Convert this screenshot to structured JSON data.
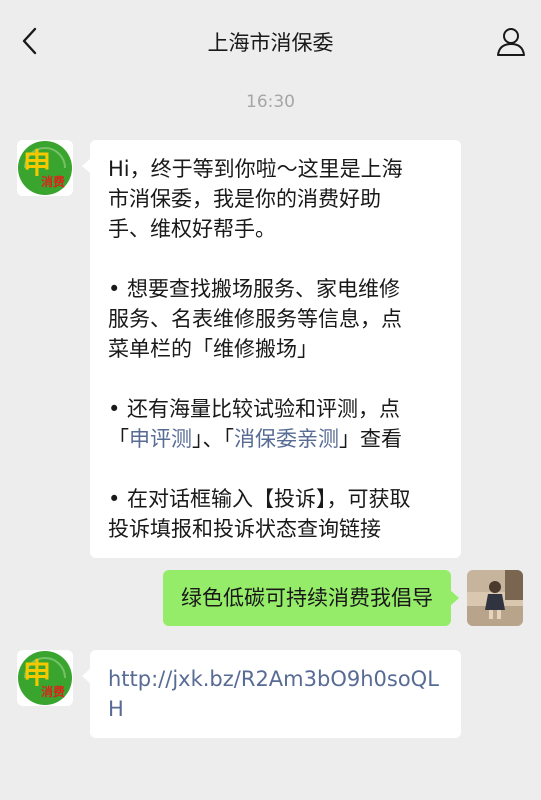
{
  "header": {
    "title": "上海市消保委",
    "back_icon": "chevron-left-icon",
    "profile_icon": "person-icon"
  },
  "chat": {
    "timestamp": "16:30",
    "org_avatar": {
      "big_char": "申",
      "small_text": "消费",
      "colors": {
        "green": "#3aa52e",
        "yellow": "#f6c800",
        "red": "#d9241c"
      }
    },
    "message1": {
      "line1": "Hi，终于等到你啦～这里是上海",
      "line2": "市消保委，我是你的消费好助",
      "line3": "手、维权好帮手。",
      "para2_line1": "• 想要查找搬场服务、家电维修",
      "para2_line2": "服务、名表维修服务等信息，点",
      "para2_line3": "菜单栏的「维修搬场」",
      "para3_line1": "• 还有海量比较试验和评测，点",
      "para3_open1": "「",
      "para3_link1": "申评测",
      "para3_mid": "」、「",
      "para3_link2": "消保委亲测",
      "para3_close": "」查看",
      "para4_line1": "• 在对话框输入【投诉】，可获取",
      "para4_line2": "投诉填报和投诉状态查询链接"
    },
    "message2": {
      "text": "绿色低碳可持续消费我倡导"
    },
    "message3": {
      "url": "http://jxk.bz/R2Am3bO9h0soQLH"
    },
    "colors": {
      "background": "#ededed",
      "incoming_bubble": "#ffffff",
      "outgoing_bubble": "#95ec69",
      "link": "#576b95",
      "timestamp": "#a6a6a6"
    }
  }
}
